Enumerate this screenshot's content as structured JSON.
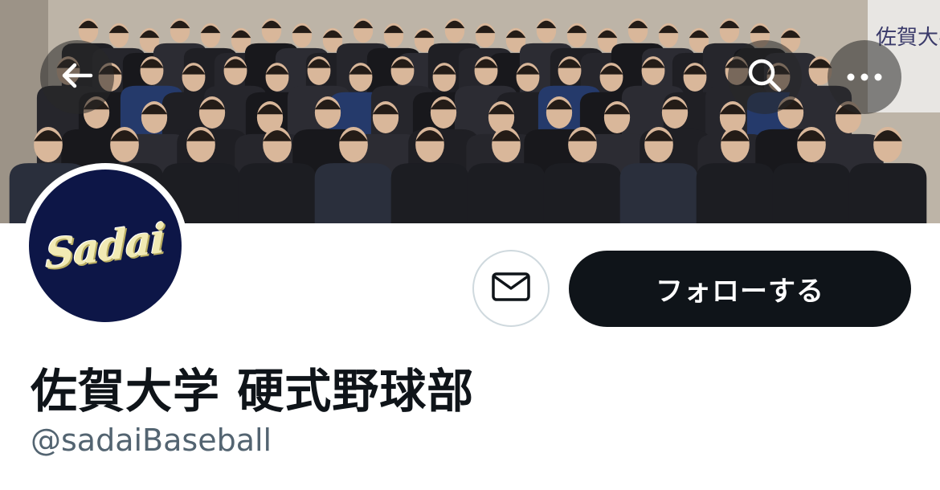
{
  "header": {
    "back_icon": "arrow-left-icon",
    "search_icon": "search-icon",
    "more_icon": "more-horizontal-icon"
  },
  "banner": {
    "description_icon": "team-group-photo",
    "sign_text": "佐賀大学\n学生とス"
  },
  "profile": {
    "avatar_logo_text": "Sadai",
    "display_name": "佐賀大学 硬式野球部",
    "handle": "@sadaiBaseball"
  },
  "actions": {
    "message_icon": "envelope-icon",
    "follow_label": "フォローする"
  },
  "colors": {
    "avatar_bg": "#0d1647",
    "avatar_logo": "#f1eab4",
    "follow_bg": "#0f1419",
    "handle_text": "#536471"
  }
}
